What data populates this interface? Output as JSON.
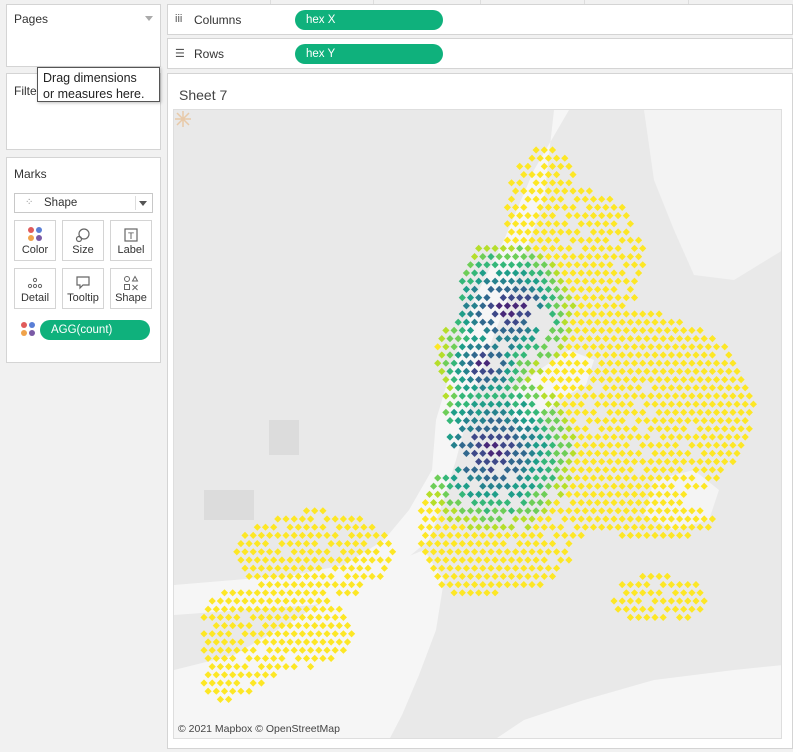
{
  "pages": {
    "title": "Pages"
  },
  "filters": {
    "title": "Filters"
  },
  "tooltip": {
    "line1": "Drag dimensions",
    "line2": "or measures here."
  },
  "marks": {
    "title": "Marks",
    "mark_type": "Shape",
    "buttons": [
      {
        "label": "Color",
        "icon": "color-icon"
      },
      {
        "label": "Size",
        "icon": "size-icon"
      },
      {
        "label": "Label",
        "icon": "label-icon"
      },
      {
        "label": "Detail",
        "icon": "detail-icon"
      },
      {
        "label": "Tooltip",
        "icon": "tooltip-icon"
      },
      {
        "label": "Shape",
        "icon": "shape-icon"
      }
    ],
    "color_field": "AGG(count)"
  },
  "columns": {
    "label": "Columns",
    "pill": "hex X"
  },
  "rows": {
    "label": "Rows",
    "pill": "hex Y"
  },
  "sheet": {
    "title": "Sheet 7"
  },
  "map": {
    "attribution": "© 2021 Mapbox © OpenStreetMap",
    "color_scale": [
      "#fde725",
      "#b5de2b",
      "#6ece58",
      "#35b779",
      "#1f9e89",
      "#26828e",
      "#31688e",
      "#3e4989",
      "#482878"
    ]
  }
}
